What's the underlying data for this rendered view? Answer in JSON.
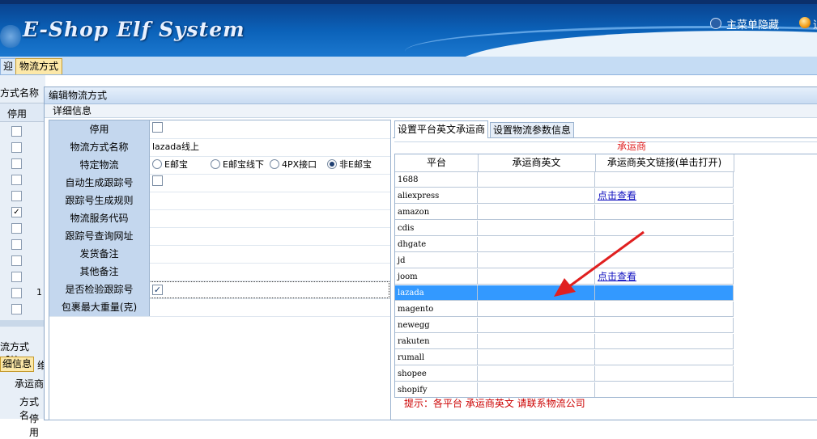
{
  "banner": {
    "logo_text": "E-Shop Elf System",
    "menu_toggle": "主菜单隐藏",
    "right_label": "退"
  },
  "tabs": {
    "welcome": "迎",
    "logistics": "物流方式"
  },
  "background_panel": {
    "header": "方式名称",
    "column": "停用",
    "row_number": "1",
    "checked_row_index": 5,
    "lower_title": "流方式【航",
    "lower_tab": "细信息",
    "lower_tab2": "维",
    "lower_label1": "承运商",
    "lower_label2": "方式名",
    "lower_label3": "停用"
  },
  "dialog": {
    "title": "编辑物流方式",
    "section": "详细信息",
    "form": {
      "disabled": {
        "label": "停用",
        "checked": false
      },
      "name": {
        "label": "物流方式名称",
        "value": "lazada线上"
      },
      "special": {
        "label": "特定物流",
        "options": [
          "E邮宝",
          "E邮宝线下",
          "4PX接口",
          "非E邮宝"
        ],
        "selected": "非E邮宝"
      },
      "auto_tracking": {
        "label": "自动生成跟踪号",
        "checked": false
      },
      "tracking_rule": {
        "label": "跟踪号生成规则",
        "value": ""
      },
      "service_code": {
        "label": "物流服务代码",
        "value": ""
      },
      "tracking_url": {
        "label": "跟踪号查询网址",
        "value": ""
      },
      "ship_note": {
        "label": "发货备注",
        "value": ""
      },
      "other_note": {
        "label": "其他备注",
        "value": ""
      },
      "verify_tracking": {
        "label": "是否检验跟踪号",
        "checked": true
      },
      "max_weight": {
        "label": "包裹最大重量(克)",
        "value": ""
      }
    },
    "right_tabs": {
      "carrier": "设置平台英文承运商",
      "params": "设置物流参数信息"
    },
    "grid": {
      "headers": [
        "平台",
        "承运商英文",
        "承运商英文链接(单击打开)"
      ],
      "rows": [
        {
          "platform": "1688",
          "carrier": "",
          "link": ""
        },
        {
          "platform": "aliexpress",
          "carrier": "",
          "link": "点击查看"
        },
        {
          "platform": "amazon",
          "carrier": "",
          "link": ""
        },
        {
          "platform": "cdis",
          "carrier": "",
          "link": ""
        },
        {
          "platform": "dhgate",
          "carrier": "",
          "link": ""
        },
        {
          "platform": "jd",
          "carrier": "",
          "link": ""
        },
        {
          "platform": "joom",
          "carrier": "",
          "link": "点击查看"
        },
        {
          "platform": "lazada",
          "carrier": "",
          "link": ""
        },
        {
          "platform": "magento",
          "carrier": "",
          "link": ""
        },
        {
          "platform": "newegg",
          "carrier": "",
          "link": ""
        },
        {
          "platform": "rakuten",
          "carrier": "",
          "link": ""
        },
        {
          "platform": "rumall",
          "carrier": "",
          "link": ""
        },
        {
          "platform": "shopee",
          "carrier": "",
          "link": ""
        },
        {
          "platform": "shopify",
          "carrier": "",
          "link": ""
        }
      ],
      "selected_row": 7
    },
    "hint": "提示：各平台 承运商英文 请联系物流公司",
    "annotation": "承运商"
  },
  "colors": {
    "banner": "#0b62b9",
    "selection": "#3399ff",
    "hint": "#cc0000",
    "annotation": "#e02020"
  }
}
